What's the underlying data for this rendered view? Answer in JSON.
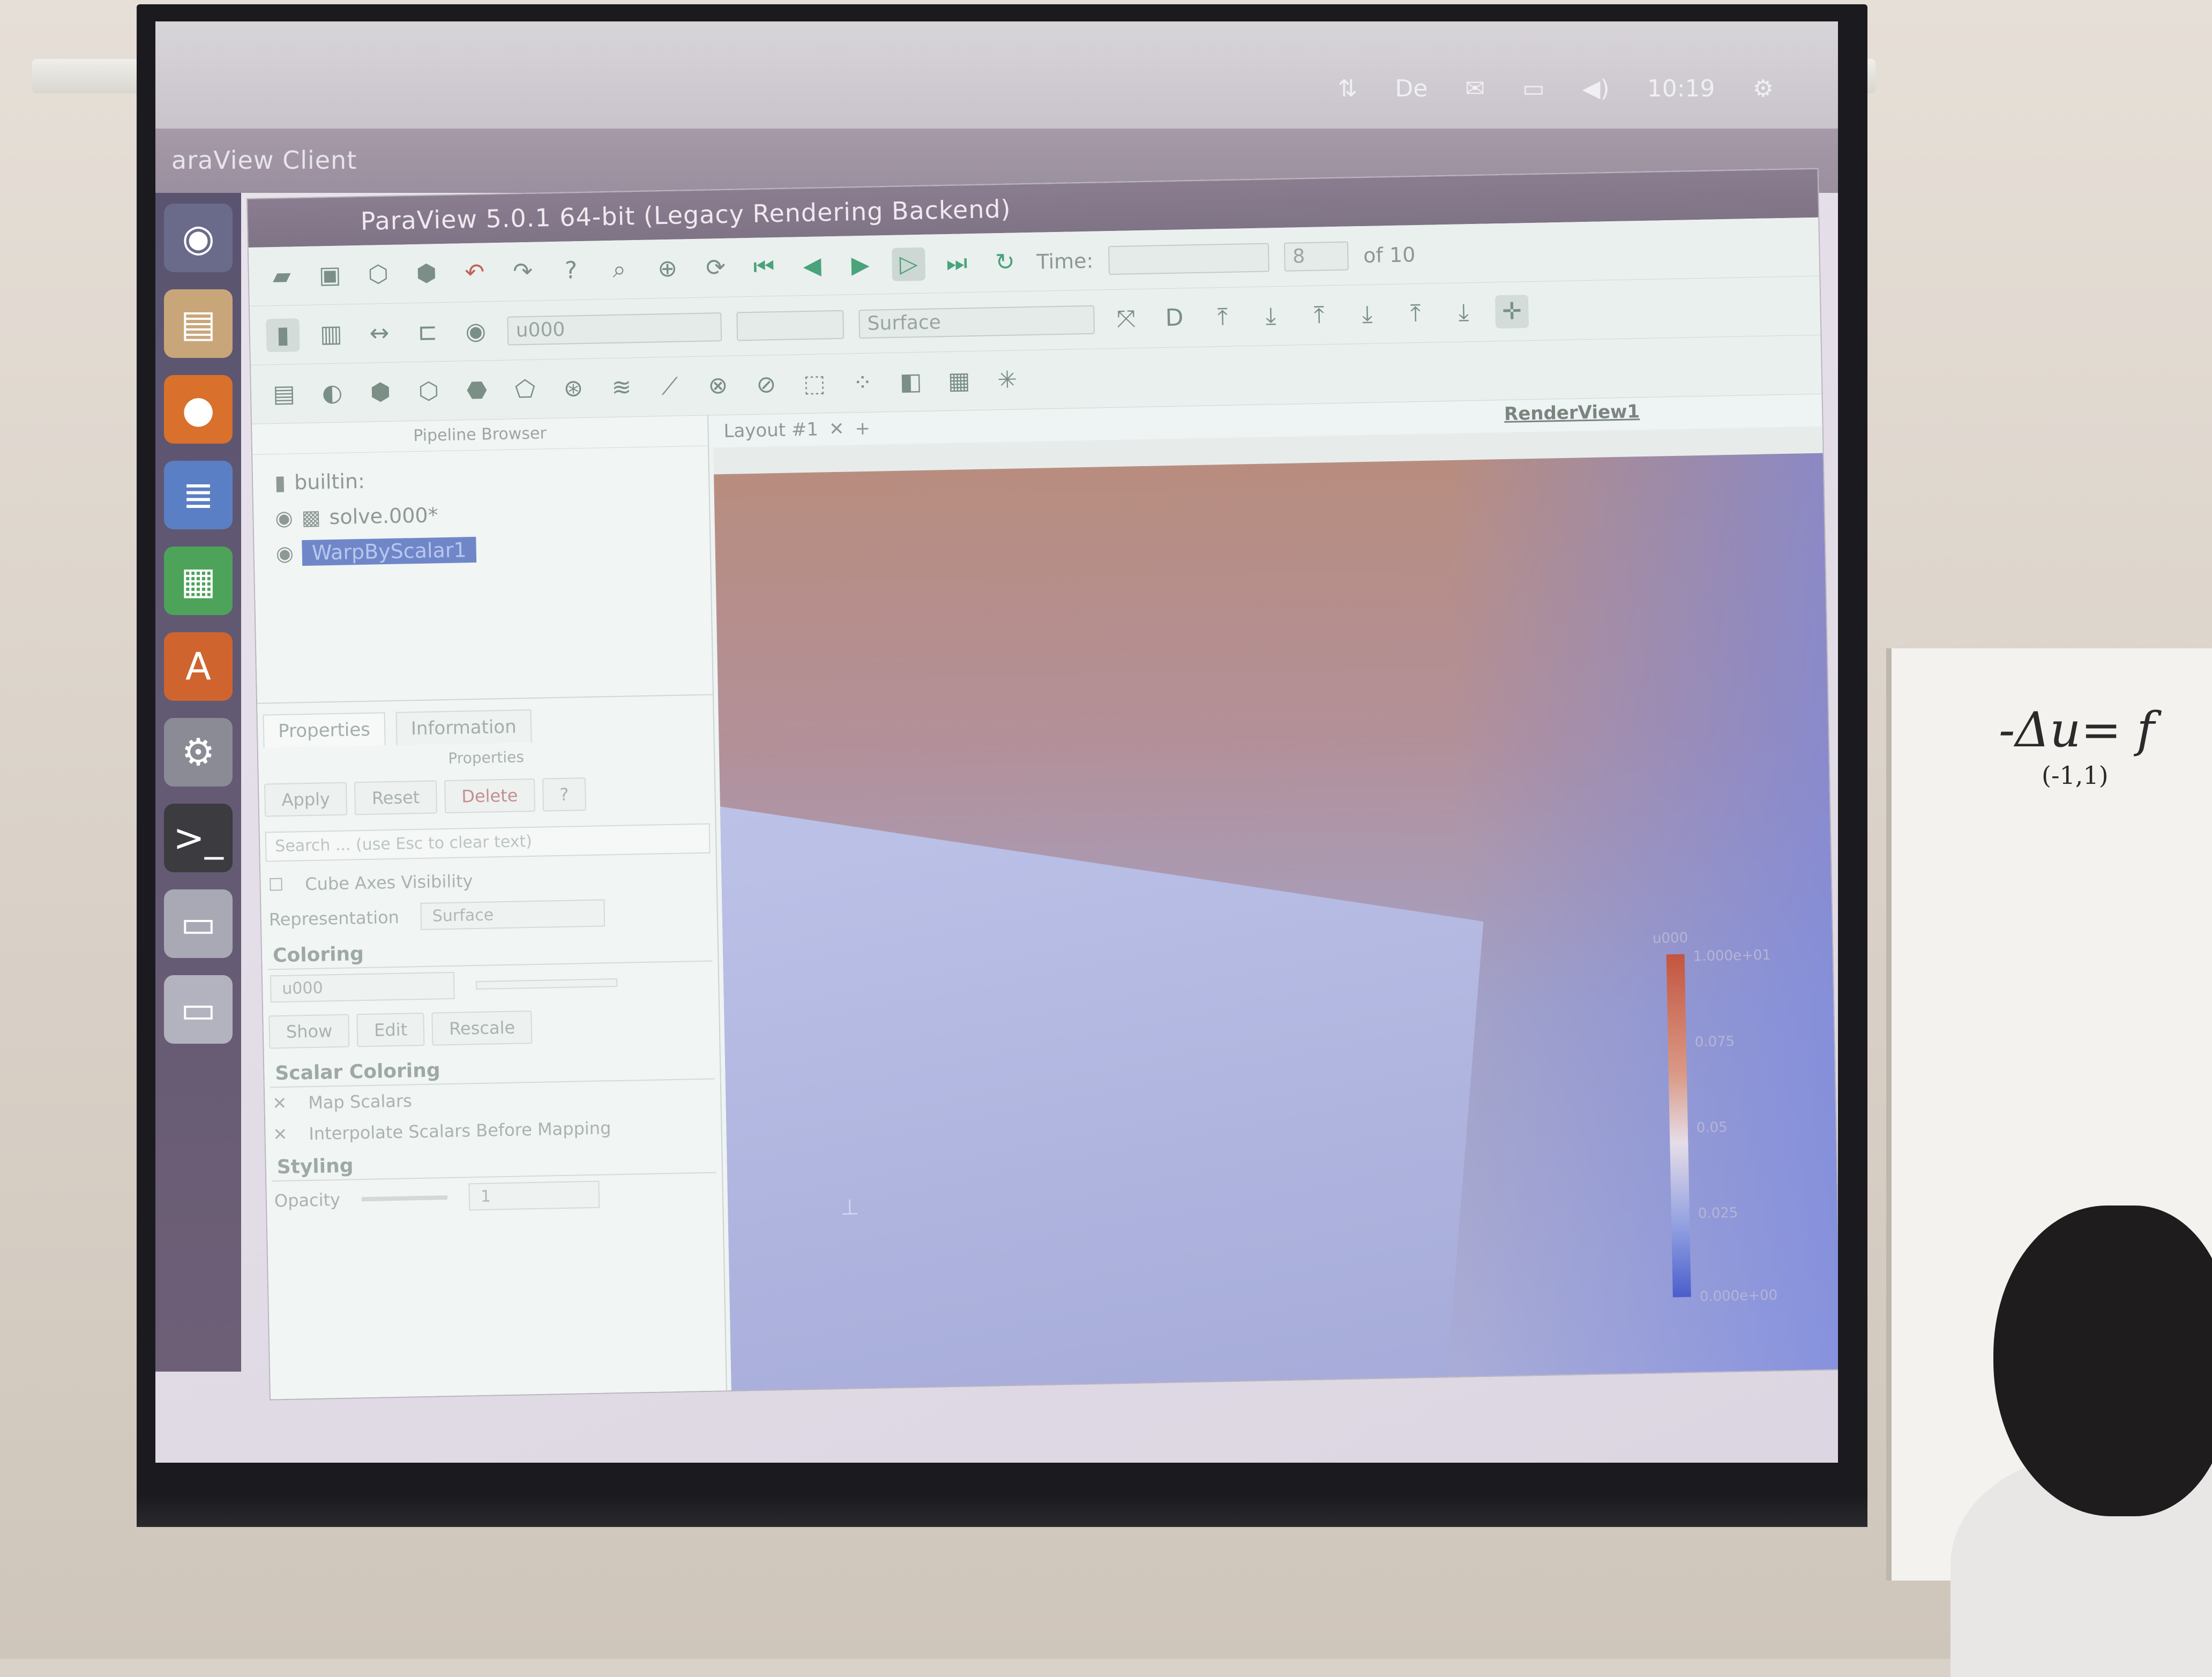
{
  "topbar": {
    "items": [
      "⇅",
      "De",
      "✉",
      "▭",
      "◀)",
      "10:19",
      "⚙"
    ]
  },
  "window": {
    "outer_title": "araView Client",
    "pv_title": "ParaView 5.0.1 64-bit (Legacy Rendering Backend)"
  },
  "toolbar": {
    "time_label": "Time:",
    "time_index": "8",
    "of_label": "of 10",
    "array_combo": "u000",
    "representation_combo": "Surface"
  },
  "pipeline": {
    "header": "Pipeline Browser",
    "items": [
      {
        "label": "builtin:"
      },
      {
        "label": "solve.000*"
      },
      {
        "label": "WarpByScalar1"
      }
    ]
  },
  "properties": {
    "tabs": [
      "Properties",
      "Information"
    ],
    "sub_header": "Properties",
    "buttons": [
      "Apply",
      "Reset",
      "Delete",
      "?"
    ],
    "search_placeholder": "Search ... (use Esc to clear text)",
    "cube_axes": "Cube Axes Visibility",
    "representation_label": "Representation",
    "representation_value": "Surface",
    "coloring_section": "Coloring",
    "coloring_array": "u000",
    "coloring_buttons": [
      "Show",
      "Edit",
      "Rescale"
    ],
    "scalar_section": "Scalar Coloring",
    "map_scalars": "Map Scalars",
    "interpolate": "Interpolate Scalars Before Mapping",
    "styling_section": "Styling",
    "opacity_label": "Opacity",
    "opacity_value": "1"
  },
  "renderview": {
    "layout_tab": "Layout #1",
    "view_name": "RenderView1",
    "colorbar_title": "u000",
    "colorbar_labels": [
      "1.000e+01",
      "0.075",
      "0.05",
      "0.025",
      "0.000e+00"
    ]
  },
  "whiteboard": {
    "line1": "-Δu= f",
    "line2": "(-1,1)"
  }
}
